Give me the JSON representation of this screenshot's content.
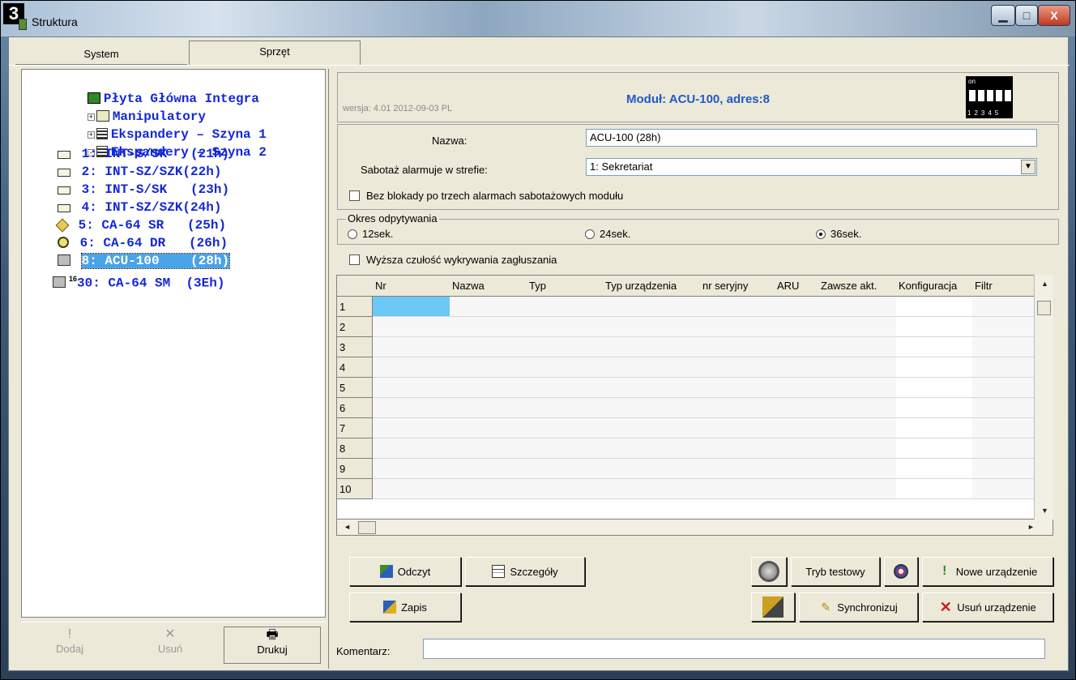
{
  "window": {
    "badge": "3",
    "title": "Struktura",
    "controls": {
      "minimize": "▁",
      "maximize": "□",
      "close": "X"
    }
  },
  "tabs": [
    {
      "label": "System"
    },
    {
      "label": "Sprzęt"
    }
  ],
  "tree": {
    "root": "Płyta Główna Integra",
    "groups": [
      {
        "label": "Manipulatory",
        "expander": "+"
      },
      {
        "label": "Ekspandery – Szyna 1",
        "expander": "+"
      },
      {
        "label": "Ekspandery – Szyna 2",
        "expander": "-"
      }
    ],
    "items": [
      {
        "label": "1: INT-S/SK   (21h)",
        "icon": "expander-icon"
      },
      {
        "label": "2: INT-SZ/SZK(22h)",
        "icon": "keypad-expander-icon"
      },
      {
        "label": "3: INT-S/SK   (23h)",
        "icon": "expander-icon"
      },
      {
        "label": "4: INT-SZ/SZK(24h)",
        "icon": "keypad-expander-icon"
      },
      {
        "label": "5: CA-64 SR   (25h)",
        "icon": "sr-module-icon"
      },
      {
        "label": "6: CA-64 DR   (26h)",
        "icon": "dr-module-icon"
      },
      {
        "label": "8: ACU-100    (28h)",
        "icon": "acu-icon",
        "selected": true
      },
      {
        "label": "30: CA-64 SM  (3Eh)",
        "icon": "sm-module-icon"
      }
    ],
    "sm_sup": "16"
  },
  "left_buttons": [
    {
      "label": "Dodaj",
      "glyph": "!",
      "disabled": true
    },
    {
      "label": "Usuń",
      "glyph": "✕",
      "disabled": true
    },
    {
      "label": "Drukuj",
      "glyph": "🖶",
      "disabled": false
    }
  ],
  "header": {
    "title": "Moduł: ACU-100, adres:8",
    "version": "wersja: 4.01 2012-09-03 PL",
    "dip_on": "on",
    "dip_numbers": "12345"
  },
  "form": {
    "name_label": "Nazwa:",
    "name_value": "ACU-100  (28h)",
    "tamper_label": "Sabotaż alarmuje w strefie:",
    "tamper_value": "1: Sekretariat",
    "no_block_label": "Bez blokady po trzech alarmach sabotażowych modułu",
    "poll_group": "Okres odpytywania",
    "poll_options": [
      "12sek.",
      "24sek.",
      "36sek."
    ],
    "poll_selected": "36sek.",
    "jam_label": "Wyższa czułość wykrywania zagłuszania"
  },
  "grid": {
    "columns": [
      "Nr",
      "Nazwa",
      "Typ",
      "Typ urządzenia",
      "nr seryjny",
      "ARU",
      "Zawsze akt.",
      "Konfiguracja",
      "Filtr"
    ],
    "rows": [
      "1",
      "2",
      "3",
      "4",
      "5",
      "6",
      "7",
      "8",
      "9",
      "10"
    ]
  },
  "buttons": {
    "read": "Odczyt",
    "details": "Szczegóły",
    "save": "Zapis",
    "test_mode": "Tryb testowy",
    "sync": "Synchronizuj",
    "new_device": "Nowe urządzenie",
    "remove_device": "Usuń urządzenie"
  },
  "comment_label": "Komentarz:"
}
